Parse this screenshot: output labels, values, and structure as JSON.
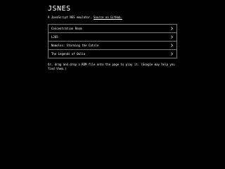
{
  "header": {
    "title": "JSNES",
    "tagline_text": "A JavaScript NES emulator.",
    "tagline_link": "Source on GitHub."
  },
  "rom_list": [
    {
      "label": "Concentration Room",
      "icon": "chevron-right-icon"
    },
    {
      "label": "LJ65",
      "icon": "chevron-right-icon"
    },
    {
      "label": "Nomolos: Storming the Catsle",
      "icon": "chevron-right-icon"
    },
    {
      "label": "The Legends of Owlia",
      "icon": "chevron-right-icon"
    }
  ],
  "hint": {
    "text": "Or, drag and drop a ROM file onto the page to play it. (Google may help you find them.)"
  },
  "colors": {
    "background": "#000000",
    "text": "#ffffff",
    "border": "#7a7a7a"
  }
}
